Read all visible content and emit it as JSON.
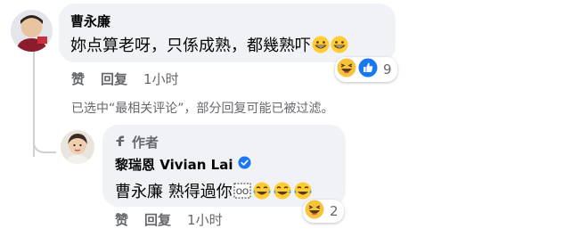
{
  "comment": {
    "author": "曹永廉",
    "text": "妳点算老呀，只係成熟，都幾熟吓",
    "text_emojis": [
      "grinning-emoji",
      "grinning-emoji"
    ],
    "reactions": {
      "icons": [
        "haha",
        "like"
      ],
      "count": "9"
    },
    "actions": {
      "like": "赞",
      "reply": "回复",
      "time": "1小时"
    }
  },
  "filter_note": "已选中“最相关评论”，部分回复可能已被过滤。",
  "reply": {
    "badge_label": "作者",
    "author": "黎瑞恩 Vivian Lai",
    "verified": true,
    "mention": "曹永廉",
    "text": "熟得過你",
    "text_emojis": [
      "boxed-oo-emoji",
      "tears-of-joy-emoji",
      "tears-of-joy-emoji",
      "tears-of-joy-emoji"
    ],
    "reactions": {
      "icons": [
        "haha"
      ],
      "count": "2"
    },
    "actions": {
      "like": "赞",
      "reply": "回复",
      "time": "1小时"
    }
  }
}
